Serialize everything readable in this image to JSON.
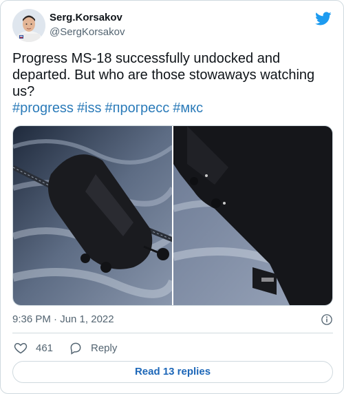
{
  "author": {
    "display_name": "Serg.Korsakov",
    "handle": "@SergKorsakov",
    "avatar_icon": "astronaut-avatar"
  },
  "tweet": {
    "text": "Progress MS-18 successfully undocked and departed. But who are those stowaways watching us?",
    "hashtags": [
      "#progress",
      "#iss",
      "#прогресс",
      "#мкс"
    ]
  },
  "media": [
    {
      "icon": "spacecraft-photo-1"
    },
    {
      "icon": "spacecraft-photo-2"
    }
  ],
  "meta": {
    "timestamp": "9:36 PM · Jun 1, 2022"
  },
  "actions": {
    "like_count": "461",
    "reply_label": "Reply"
  },
  "read_replies_label": "Read 13 replies",
  "colors": {
    "link": "#2b7bb9",
    "twitter_blue": "#1d9bf0",
    "muted": "#536471",
    "border": "#cfd9de"
  }
}
